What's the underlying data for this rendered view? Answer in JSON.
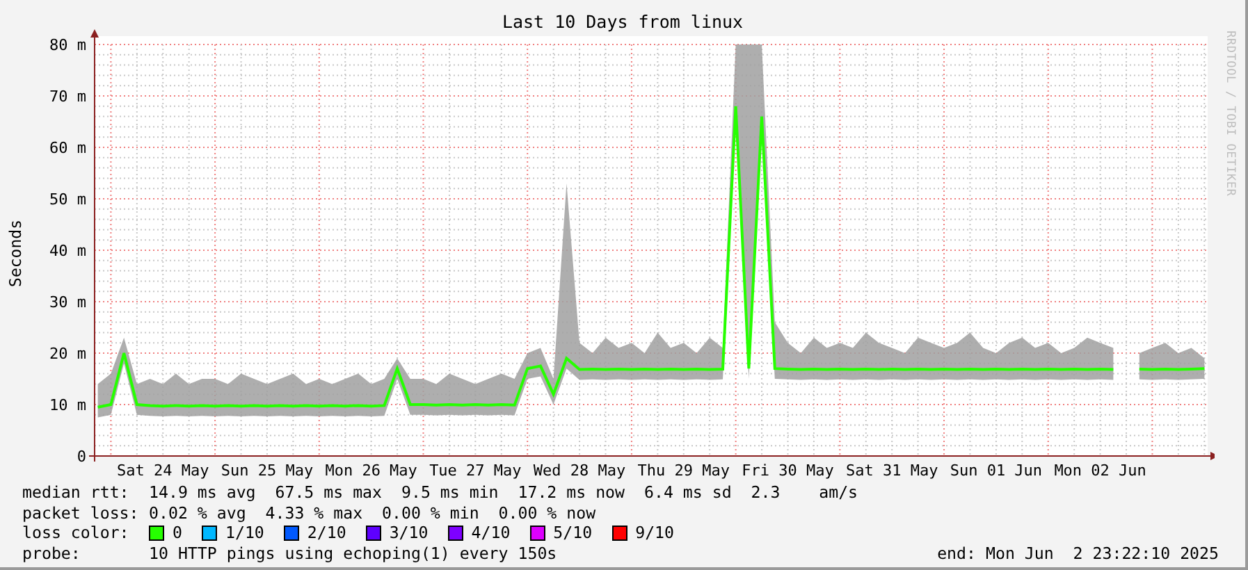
{
  "chart": {
    "chart_data": {
      "type": "line",
      "title": "Last 10 Days from linux",
      "ylabel": "Seconds",
      "categories": [
        null,
        null,
        null,
        null,
        null,
        "Sat 24 May",
        null,
        null,
        null,
        null,
        null,
        null,
        null,
        "Sun 25 May",
        null,
        null,
        null,
        null,
        null,
        null,
        null,
        "Mon 26 May",
        null,
        null,
        null,
        null,
        null,
        null,
        null,
        "Tue 27 May",
        null,
        null,
        null,
        null,
        null,
        null,
        null,
        "Wed 28 May",
        null,
        null,
        null,
        null,
        null,
        null,
        null,
        "Thu 29 May",
        null,
        null,
        null,
        null,
        null,
        null,
        null,
        "Fri 30 May",
        null,
        null,
        null,
        null,
        null,
        null,
        null,
        "Sat 31 May",
        null,
        null,
        null,
        null,
        null,
        null,
        null,
        "Sun 01 Jun",
        null,
        null,
        null,
        null,
        null,
        null,
        null,
        "Mon 02 Jun",
        null,
        null,
        null,
        null,
        null,
        null,
        null,
        null
      ],
      "series": [
        {
          "type": "line",
          "color": "#26ff00",
          "values": [
            9.5,
            10,
            20,
            10,
            9.8,
            9.7,
            9.8,
            9.7,
            9.8,
            9.7,
            9.8,
            9.7,
            9.8,
            9.7,
            9.8,
            9.7,
            9.8,
            9.7,
            9.8,
            9.7,
            9.8,
            9.7,
            9.8,
            17,
            10,
            10,
            9.9,
            10,
            9.9,
            10,
            9.9,
            10,
            9.9,
            17,
            17.5,
            12,
            19,
            16.8,
            16.9,
            16.8,
            16.9,
            16.8,
            16.9,
            16.8,
            16.9,
            16.8,
            16.9,
            16.8,
            16.9,
            68,
            17,
            66,
            17,
            16.9,
            16.8,
            16.9,
            16.8,
            16.9,
            16.8,
            16.9,
            16.8,
            16.9,
            16.8,
            16.9,
            16.8,
            16.9,
            16.8,
            16.9,
            16.8,
            16.9,
            16.8,
            16.9,
            16.8,
            16.9,
            16.8,
            16.9,
            16.8,
            16.9,
            16.8,
            null,
            16.9,
            16.8,
            16.9,
            16.8,
            16.9,
            17
          ]
        },
        {
          "type": "area",
          "color": "#a0a0a0",
          "values": [
            14,
            16,
            23,
            14,
            15,
            14,
            16,
            14,
            15,
            15,
            14,
            16,
            15,
            14,
            15,
            16,
            14,
            15,
            14,
            15,
            16,
            14,
            15,
            19,
            15,
            15,
            14,
            16,
            15,
            14,
            15,
            16,
            15,
            20,
            21,
            15,
            53,
            22,
            20,
            23,
            21,
            22,
            20,
            24,
            21,
            22,
            20,
            23,
            21,
            80,
            80,
            80,
            26,
            22,
            20,
            23,
            21,
            22,
            21,
            24,
            22,
            21,
            20,
            23,
            22,
            21,
            22,
            24,
            21,
            20,
            22,
            23,
            21,
            22,
            20,
            21,
            23,
            22,
            21,
            null,
            20,
            21,
            22,
            20,
            21,
            19
          ]
        }
      ],
      "ylim": [
        0,
        80
      ],
      "grid": true,
      "yticks": [
        {
          "value": 0,
          "label": "0"
        },
        {
          "value": 10,
          "label": "10 m"
        },
        {
          "value": 20,
          "label": "20 m"
        },
        {
          "value": 30,
          "label": "30 m"
        },
        {
          "value": 40,
          "label": "40 m"
        },
        {
          "value": 50,
          "label": "50 m"
        },
        {
          "value": 60,
          "label": "60 m"
        },
        {
          "value": 70,
          "label": "70 m"
        },
        {
          "value": 80,
          "label": "80 m"
        }
      ]
    },
    "credit": "RRDTOOL / TOBI OETIKER"
  },
  "legend": [
    {
      "kind": "stats",
      "label": "median rtt:",
      "text": "14.9 ms avg  67.5 ms max  9.5 ms min  17.2 ms now  6.4 ms sd  2.3    am/s"
    },
    {
      "kind": "stats",
      "label": "packet loss:",
      "text": "0.02 % avg  4.33 % max  0.00 % min  0.00 % now"
    },
    {
      "kind": "colors",
      "label": "loss color:",
      "swatches": [
        {
          "label": "0",
          "color": "#26ff00"
        },
        {
          "label": "1/10",
          "color": "#00b8ff"
        },
        {
          "label": "2/10",
          "color": "#0059ff"
        },
        {
          "label": "3/10",
          "color": "#5e00ff"
        },
        {
          "label": "4/10",
          "color": "#7e00ff"
        },
        {
          "label": "5/10",
          "color": "#dd00ff"
        },
        {
          "label": "9/10",
          "color": "#ff0000"
        }
      ]
    },
    {
      "kind": "stats",
      "label": "probe:",
      "text": "10 HTTP pings using echoping(1) every 150s"
    }
  ],
  "end": "end: Mon Jun  2 23:22:10 2025"
}
